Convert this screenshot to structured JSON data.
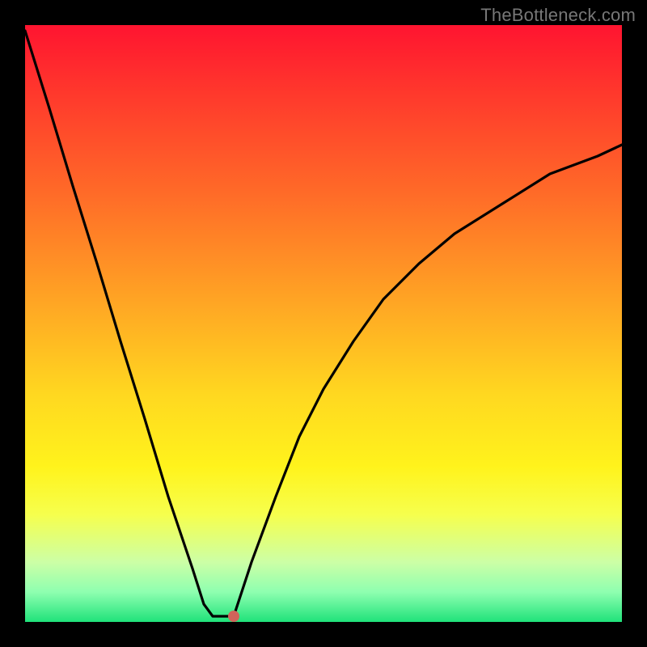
{
  "watermark": "TheBottleneck.com",
  "chart_data": {
    "type": "line",
    "title": "",
    "xlabel": "",
    "ylabel": "",
    "xlim": [
      0,
      100
    ],
    "ylim": [
      0,
      100
    ],
    "grid": false,
    "legend": false,
    "series": [
      {
        "name": "curve-left",
        "x": [
          0,
          4,
          8,
          12,
          16,
          20,
          24,
          28,
          30,
          31.5
        ],
        "y": [
          99,
          86,
          73,
          60,
          47,
          34,
          21,
          9,
          3,
          1
        ]
      },
      {
        "name": "flat-bottom",
        "x": [
          31.5,
          35
        ],
        "y": [
          1,
          1
        ]
      },
      {
        "name": "curve-right",
        "x": [
          35,
          38,
          42,
          46,
          50,
          55,
          60,
          66,
          72,
          80,
          88,
          96,
          100
        ],
        "y": [
          1,
          10,
          21,
          31,
          39,
          47,
          54,
          60,
          65,
          70,
          75,
          78,
          80
        ]
      }
    ],
    "marker": {
      "x": 35,
      "y": 1
    }
  },
  "colors": {
    "background": "#000000",
    "curve": "#000000",
    "marker": "#d1645a"
  }
}
